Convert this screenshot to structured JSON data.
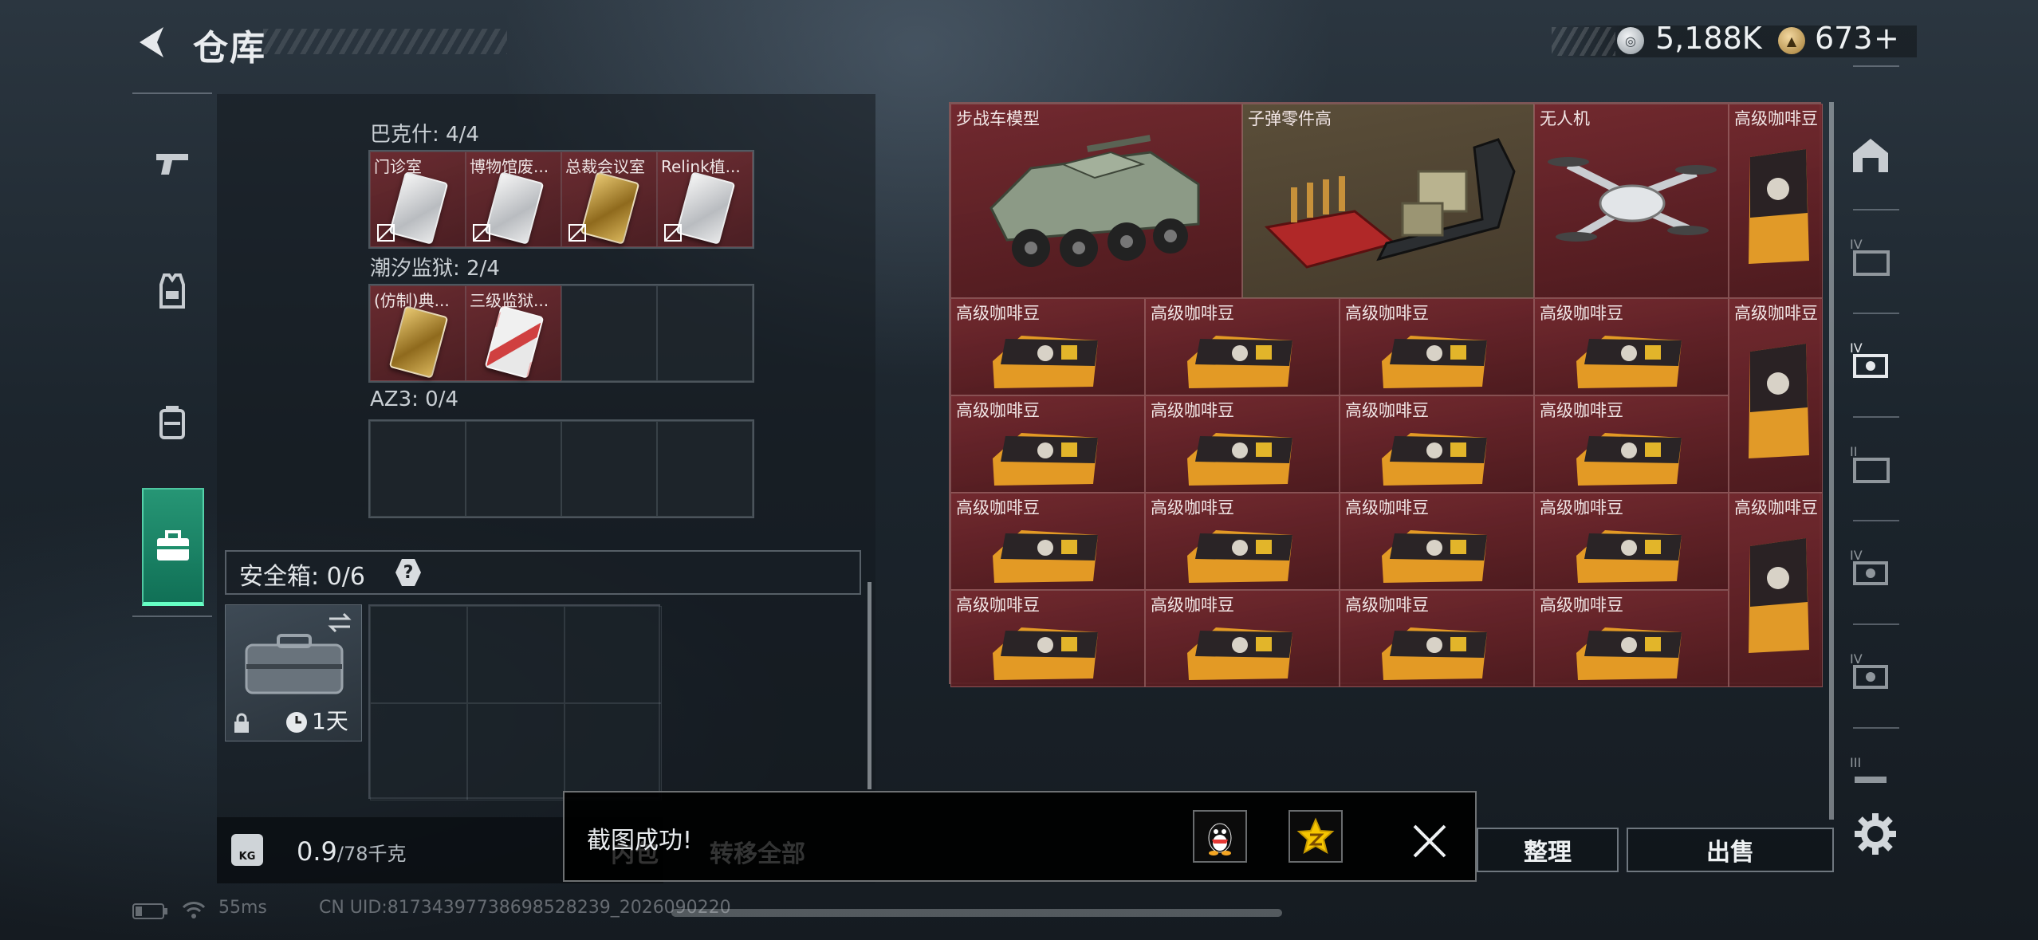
{
  "header": {
    "title": "仓库",
    "silver_amount": "5,188K",
    "gold_amount": "673",
    "gold_plus": "+"
  },
  "left_rail": {
    "items": [
      {
        "name": "weapon-tab",
        "icon": "pistol-icon"
      },
      {
        "name": "armor-tab",
        "icon": "vest-icon"
      },
      {
        "name": "backpack-tab",
        "icon": "backpack-icon"
      },
      {
        "name": "case-tab",
        "icon": "briefcase-icon",
        "active": true
      }
    ]
  },
  "key_groups": [
    {
      "label": "巴克什: 4/4",
      "slots": [
        {
          "name": "门诊室",
          "card": "white"
        },
        {
          "name": "博物馆废...",
          "card": "white"
        },
        {
          "name": "总裁会议室",
          "card": "gold"
        },
        {
          "name": "Relink植...",
          "card": "white"
        }
      ]
    },
    {
      "label": "潮汐监狱: 2/4",
      "slots": [
        {
          "name": "(仿制)典...",
          "card": "gold"
        },
        {
          "name": "三级监狱...",
          "card": "red"
        },
        {
          "name": "",
          "card": ""
        },
        {
          "name": "",
          "card": ""
        }
      ]
    },
    {
      "label": "AZ3: 0/4",
      "slots": [
        {
          "name": "",
          "card": ""
        },
        {
          "name": "",
          "card": ""
        },
        {
          "name": "",
          "card": ""
        },
        {
          "name": "",
          "card": ""
        }
      ]
    }
  ],
  "safe_box": {
    "title": "安全箱: 0/6",
    "help": "?",
    "duration": "1天"
  },
  "weight": {
    "current": "0.9",
    "max": "/78千克",
    "icon_text": "KG"
  },
  "inventory": {
    "top_row": [
      {
        "label": "步战车模型"
      },
      {
        "label": "子弹零件高"
      },
      {
        "label": "无人机"
      },
      {
        "label": "高级咖啡豆"
      }
    ],
    "grid_label": "高级咖啡豆",
    "tall_label": "高级咖啡豆"
  },
  "actions": {
    "sort": "整理",
    "sell": "出售"
  },
  "toast": {
    "message": "截图成功!",
    "ghost_left": "内包",
    "ghost_right": "转移全部"
  },
  "status": {
    "ping": "55ms",
    "uid": "CN UID:81734397738698528239_2026090220"
  },
  "colors": {
    "accent_green": "#2fb98a",
    "item_red": "#7a2a30",
    "coin_gold": "#c9a259"
  }
}
